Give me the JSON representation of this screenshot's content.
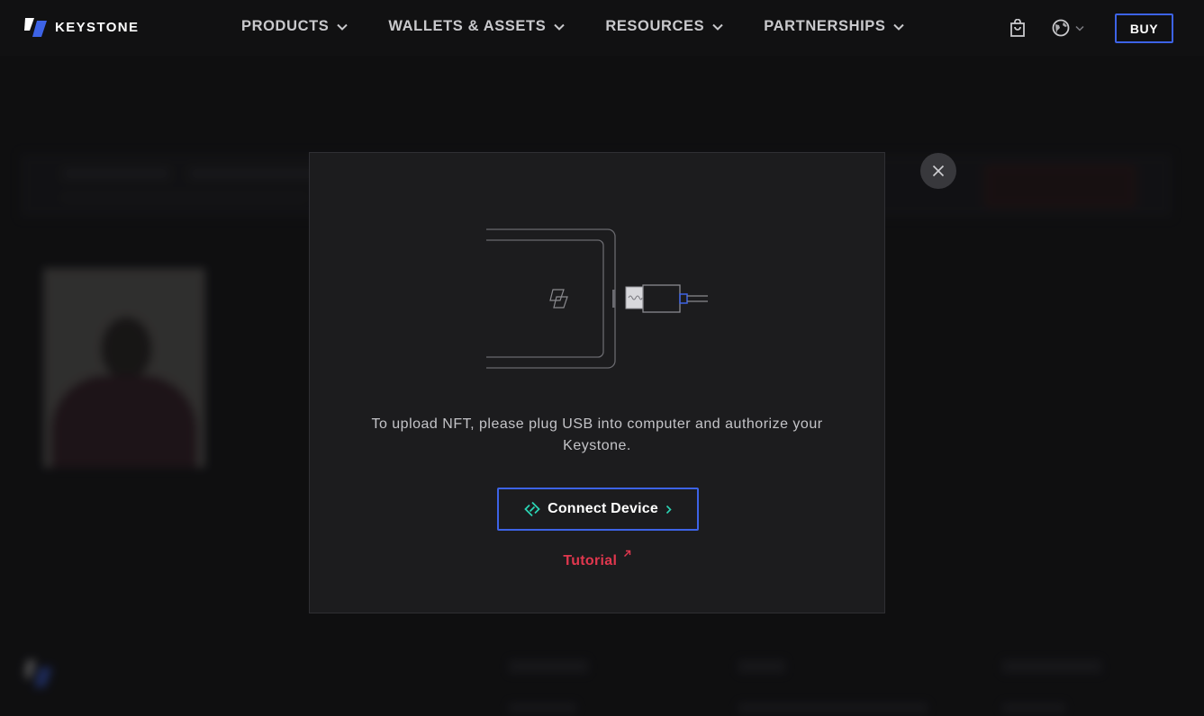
{
  "header": {
    "brand": "KEYSTONE",
    "nav": [
      {
        "label": "PRODUCTS"
      },
      {
        "label": "WALLETS & ASSETS"
      },
      {
        "label": "RESOURCES"
      },
      {
        "label": "PARTNERSHIPS"
      }
    ],
    "buy_label": "BUY"
  },
  "modal": {
    "message": "To upload NFT, please plug USB into computer and authorize your Keystone.",
    "connect_label": "Connect Device",
    "tutorial_label": "Tutorial"
  },
  "colors": {
    "accent_blue": "#3d63e6",
    "tutorial_red": "#e0374e",
    "teal": "#2bd4b4"
  }
}
